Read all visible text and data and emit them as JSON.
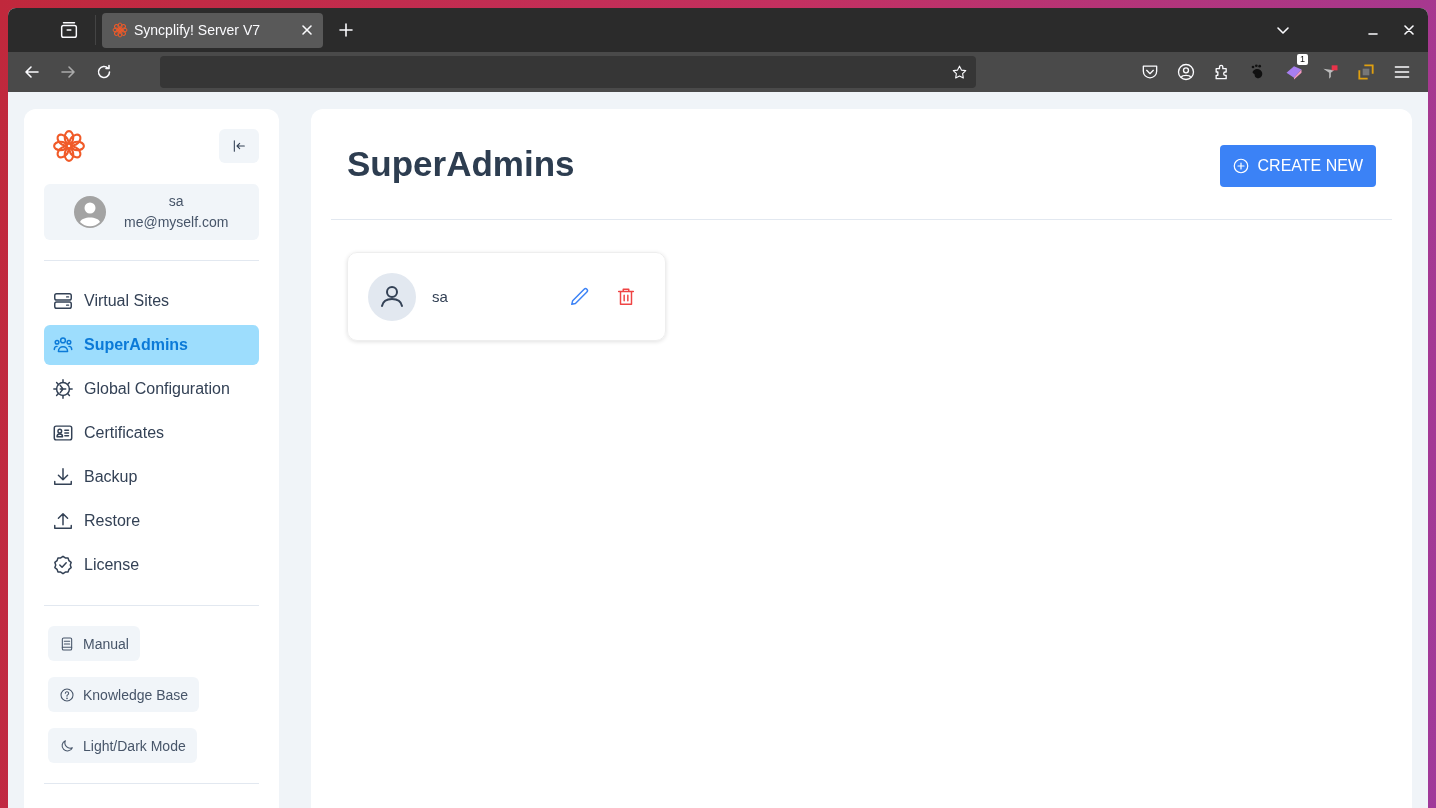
{
  "browser": {
    "tab_title": "Syncplify! Server V7",
    "extension_badge": "1"
  },
  "sidebar": {
    "user": {
      "name": "sa",
      "email": "me@myself.com"
    },
    "nav": [
      {
        "label": "Virtual Sites",
        "kind": "server",
        "selected": false
      },
      {
        "label": "SuperAdmins",
        "kind": "users",
        "selected": true
      },
      {
        "label": "Global Configuration",
        "kind": "gear",
        "selected": false
      },
      {
        "label": "Certificates",
        "kind": "card",
        "selected": false
      },
      {
        "label": "Backup",
        "kind": "download",
        "selected": false
      },
      {
        "label": "Restore",
        "kind": "upload",
        "selected": false
      },
      {
        "label": "License",
        "kind": "badge",
        "selected": false
      }
    ],
    "links": [
      {
        "label": "Manual",
        "kind": "book"
      },
      {
        "label": "Knowledge Base",
        "kind": "help"
      },
      {
        "label": "Light/Dark Mode",
        "kind": "moon"
      }
    ]
  },
  "page": {
    "title": "SuperAdmins",
    "create_button": "CREATE NEW",
    "admins": [
      {
        "name": "sa"
      }
    ]
  }
}
